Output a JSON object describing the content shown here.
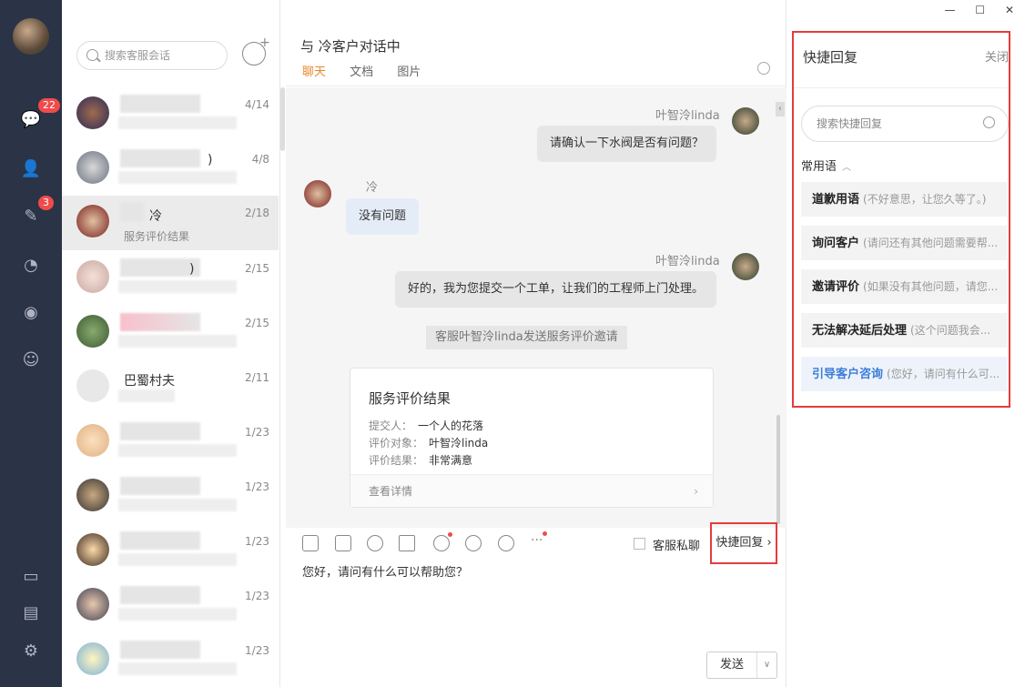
{
  "rail": {
    "badges": {
      "messages": "22",
      "tasks": "3"
    }
  },
  "contacts": {
    "search_placeholder": "搜索客服会话",
    "items": [
      {
        "name": "",
        "date": "4/14",
        "sub": ""
      },
      {
        "name": ")",
        "date": "4/8",
        "sub": ""
      },
      {
        "name": "冷",
        "date": "2/18",
        "sub": "服务评价结果"
      },
      {
        "name": ")",
        "date": "2/15",
        "sub": ""
      },
      {
        "name": "",
        "date": "2/15",
        "sub": ""
      },
      {
        "name": "巴蜀村夫",
        "date": "2/11",
        "sub": ""
      },
      {
        "name": "",
        "date": "1/23",
        "sub": ""
      },
      {
        "name": "",
        "date": "1/23",
        "sub": ""
      },
      {
        "name": "",
        "date": "1/23",
        "sub": ""
      },
      {
        "name": "",
        "date": "1/23",
        "sub": ""
      },
      {
        "name": "",
        "date": "1/23",
        "sub": ""
      }
    ]
  },
  "chat": {
    "title": "与  冷客户对话中",
    "tabs": [
      "聊天",
      "文档",
      "图片"
    ],
    "messages": [
      {
        "sender": "叶智泠linda",
        "text": "请确认一下水阀是否有问题？"
      },
      {
        "sender": "冷",
        "text": "没有问题"
      },
      {
        "sender": "叶智泠linda",
        "text": "好的，我为您提交一个工单，让我们的工程师上门处理。"
      }
    ],
    "system_notice": "客服叶智泠linda发送服务评价邀请",
    "card": {
      "title": "服务评价结果",
      "submitter_label": "提交人：",
      "submitter": "一个人的花落",
      "target_label": "评价对象：",
      "target": "叶智泠linda",
      "result_label": "评价结果：",
      "result": "非常满意",
      "detail": "查看详情"
    },
    "private_label": "客服私聊",
    "quick_reply_button": "快捷回复",
    "input_text": "您好，请问有什么可以帮助您？",
    "send": "发送"
  },
  "quick_reply": {
    "title": "快捷回复",
    "close": "关闭",
    "search_placeholder": "搜索快捷回复",
    "group": "常用语",
    "items": [
      {
        "title": "道歉用语",
        "text": "(不好意思，让您久等了。)"
      },
      {
        "title": "询问客户",
        "text": "(请问还有其他问题需要帮..."
      },
      {
        "title": "邀请评价",
        "text": "(如果没有其他问题，请您..."
      },
      {
        "title": "无法解决延后处理",
        "text": "(这个问题我会..."
      },
      {
        "title": "引导客户咨询",
        "text": "(您好，请问有什么可..."
      }
    ]
  },
  "colors": {
    "accent": "#e88a2a",
    "highlight": "#e53c3c",
    "link": "#3b7dd8"
  }
}
